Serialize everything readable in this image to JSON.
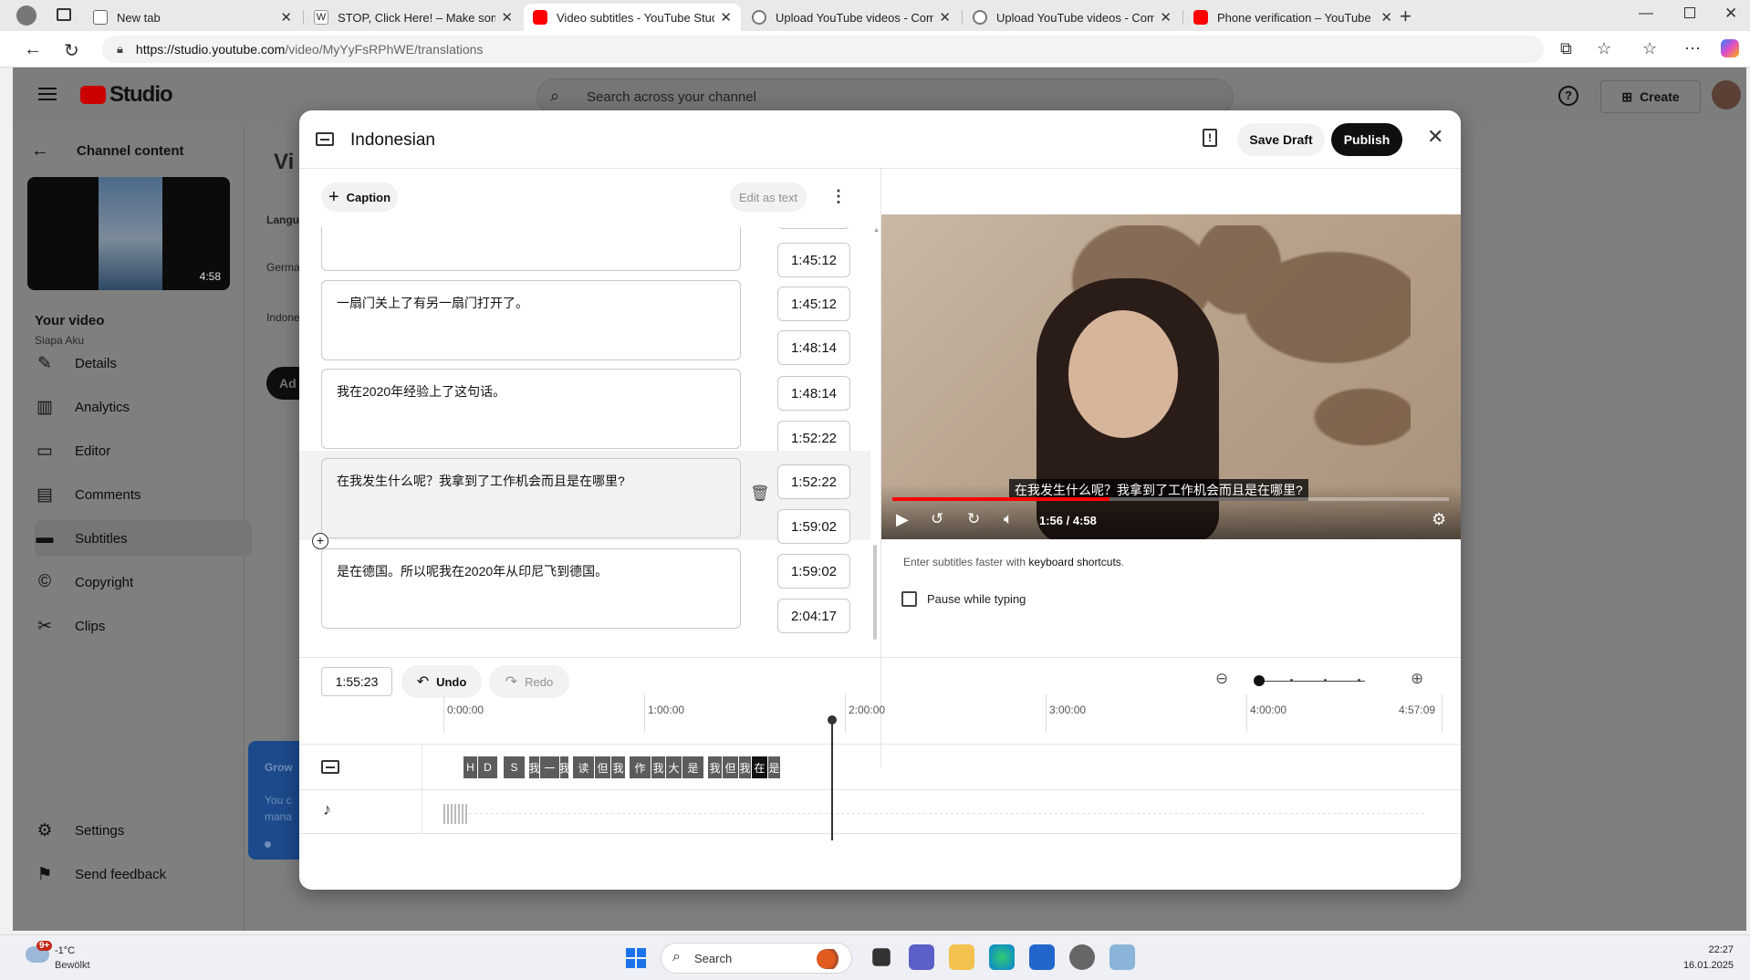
{
  "browser": {
    "tabs": [
      {
        "title": "New tab",
        "active": false
      },
      {
        "title": "STOP, Click Here! – Make some n",
        "active": false
      },
      {
        "title": "Video subtitles - YouTube Studio",
        "active": true
      },
      {
        "title": "Upload YouTube videos - Comput",
        "active": false
      },
      {
        "title": "Upload YouTube videos - Comput",
        "active": false
      },
      {
        "title": "Phone verification – YouTube",
        "active": false
      }
    ],
    "url_domain": "https://studio.youtube.com",
    "url_path": "/video/MyYyFsRPhWE/translations"
  },
  "studio": {
    "logo_text": "Studio",
    "search_placeholder": "Search across your channel",
    "create_label": "Create"
  },
  "sidebar": {
    "back_label": "Channel content",
    "video_duration": "4:58",
    "your_video_label": "Your video",
    "channel_name": "Siapa Aku",
    "items": [
      {
        "label": "Details",
        "icon": "pencil-icon"
      },
      {
        "label": "Analytics",
        "icon": "analytics-icon"
      },
      {
        "label": "Editor",
        "icon": "editor-icon"
      },
      {
        "label": "Comments",
        "icon": "comments-icon"
      },
      {
        "label": "Subtitles",
        "icon": "subtitles-icon",
        "active": true
      },
      {
        "label": "Copyright",
        "icon": "copyright-icon"
      },
      {
        "label": "Clips",
        "icon": "scissors-icon"
      }
    ],
    "settings_label": "Settings",
    "feedback_label": "Send feedback"
  },
  "background": {
    "title_partial": "Vi",
    "lang_header": "Langu",
    "rows": [
      "Germa",
      "Indone"
    ],
    "add_btn": "Ad",
    "grow_title": "Grow",
    "grow_text1": "You c",
    "grow_text2": "mana"
  },
  "modal": {
    "title": "Indonesian",
    "save_draft": "Save Draft",
    "publish": "Publish",
    "add_caption": "Caption",
    "edit_as_text": "Edit as text",
    "cues": [
      {
        "text": "",
        "start": "",
        "end": "1:45:12"
      },
      {
        "text": "一扇门关上了有另一扇门打开了。",
        "start": "1:45:12",
        "end": "1:48:14"
      },
      {
        "text": "我在2020年经验上了这句话。",
        "start": "1:48:14",
        "end": "1:52:22"
      },
      {
        "text": "在我发生什么呢？我拿到了工作机会而且是在哪里?",
        "start": "1:52:22",
        "end": "1:59:02"
      },
      {
        "text": "是在德国。所以呢我在2020年从印尼飞到德国。",
        "start": "1:59:02",
        "end": "2:04:17"
      }
    ],
    "player": {
      "subtitle_overlay": "在我发生什么呢？我拿到了工作机会而且是在哪里?",
      "time": "1:56 / 4:58",
      "progress": 0.39
    },
    "shortcuts_prefix": "Enter subtitles faster with ",
    "shortcuts_link": "keyboard shortcuts",
    "shortcuts_suffix": ".",
    "pause_label": "Pause while typing",
    "current_time": "1:55:23",
    "undo": "Undo",
    "redo": "Redo",
    "timeline_ticks": [
      "0:00:00",
      "1:00:00",
      "2:00:00",
      "3:00:00",
      "4:00:00",
      "4:57:09"
    ],
    "segments": [
      "H",
      "D",
      "S",
      "我",
      "一",
      "我",
      "读",
      "但",
      "我",
      "作",
      "我",
      "大",
      "是",
      "我",
      "但",
      "我",
      "在",
      "是"
    ]
  },
  "taskbar": {
    "temp": "-1°C",
    "weather": "Bewölkt",
    "badge": "9+",
    "search": "Search",
    "time": "22:27",
    "date": "16.01.2025"
  }
}
